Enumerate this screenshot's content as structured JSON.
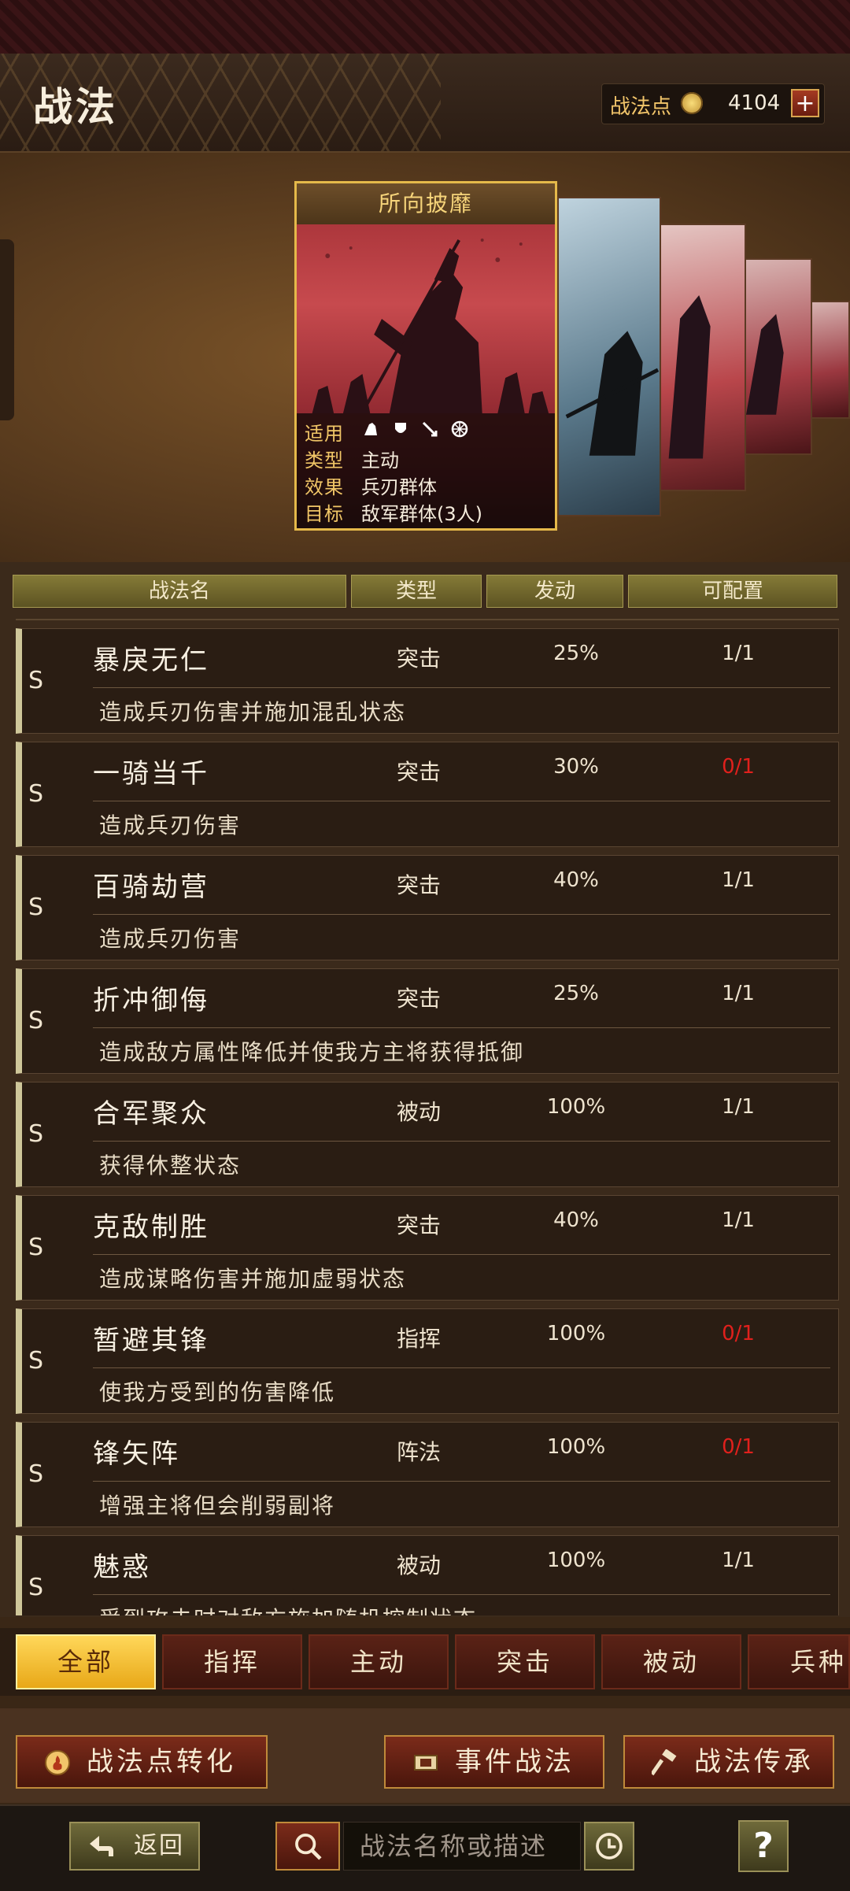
{
  "header": {
    "title": "战法",
    "points_label": "战法点",
    "points_value": "4104",
    "plus_symbol": "+"
  },
  "featured_card": {
    "name": "所向披靡",
    "info": [
      {
        "key": "适用",
        "value": ""
      },
      {
        "key": "类型",
        "value": "主动"
      },
      {
        "key": "效果",
        "value": "兵刃群体"
      },
      {
        "key": "目标",
        "value": "敌军群体(3人)"
      }
    ],
    "applicable_icons": [
      "cavalry-icon",
      "shield-icon",
      "archer-icon",
      "chariot-icon"
    ]
  },
  "table": {
    "headers": [
      "战法名",
      "类型",
      "发动",
      "可配置"
    ],
    "rows": [
      {
        "grade": "S",
        "name": "暴戾无仁",
        "type": "突击",
        "rate": "25%",
        "config": "1/1",
        "available": true,
        "desc": "造成兵刃伤害并施加混乱状态"
      },
      {
        "grade": "S",
        "name": "一骑当千",
        "type": "突击",
        "rate": "30%",
        "config": "0/1",
        "available": false,
        "desc": "造成兵刃伤害"
      },
      {
        "grade": "S",
        "name": "百骑劫营",
        "type": "突击",
        "rate": "40%",
        "config": "1/1",
        "available": true,
        "desc": "造成兵刃伤害"
      },
      {
        "grade": "S",
        "name": "折冲御侮",
        "type": "突击",
        "rate": "25%",
        "config": "1/1",
        "available": true,
        "desc": "造成敌方属性降低并使我方主将获得抵御"
      },
      {
        "grade": "S",
        "name": "合军聚众",
        "type": "被动",
        "rate": "100%",
        "config": "1/1",
        "available": true,
        "desc": "获得休整状态"
      },
      {
        "grade": "S",
        "name": "克敌制胜",
        "type": "突击",
        "rate": "40%",
        "config": "1/1",
        "available": true,
        "desc": "造成谋略伤害并施加虚弱状态"
      },
      {
        "grade": "S",
        "name": "暂避其锋",
        "type": "指挥",
        "rate": "100%",
        "config": "0/1",
        "available": false,
        "desc": "使我方受到的伤害降低"
      },
      {
        "grade": "S",
        "name": "锋矢阵",
        "type": "阵法",
        "rate": "100%",
        "config": "0/1",
        "available": false,
        "desc": "增强主将但会削弱副将"
      },
      {
        "grade": "S",
        "name": "魅惑",
        "type": "被动",
        "rate": "100%",
        "config": "1/1",
        "available": true,
        "desc": "受到攻击时对敌方施加随机控制状态"
      }
    ]
  },
  "filter_tabs": [
    {
      "label": "全部",
      "active": true
    },
    {
      "label": "指挥",
      "active": false
    },
    {
      "label": "主动",
      "active": false
    },
    {
      "label": "突击",
      "active": false
    },
    {
      "label": "被动",
      "active": false
    },
    {
      "label": "兵种",
      "active": false
    }
  ],
  "actions": {
    "convert_label": "战法点转化",
    "event_label": "事件战法",
    "inherit_label": "战法传承"
  },
  "bottom": {
    "back_label": "返回",
    "search_placeholder": "战法名称或描述",
    "help_symbol": "?"
  },
  "colors": {
    "accent_gold": "#e5b94a",
    "unavailable_red": "#e0201c",
    "active_tab": "#ffd75a"
  }
}
